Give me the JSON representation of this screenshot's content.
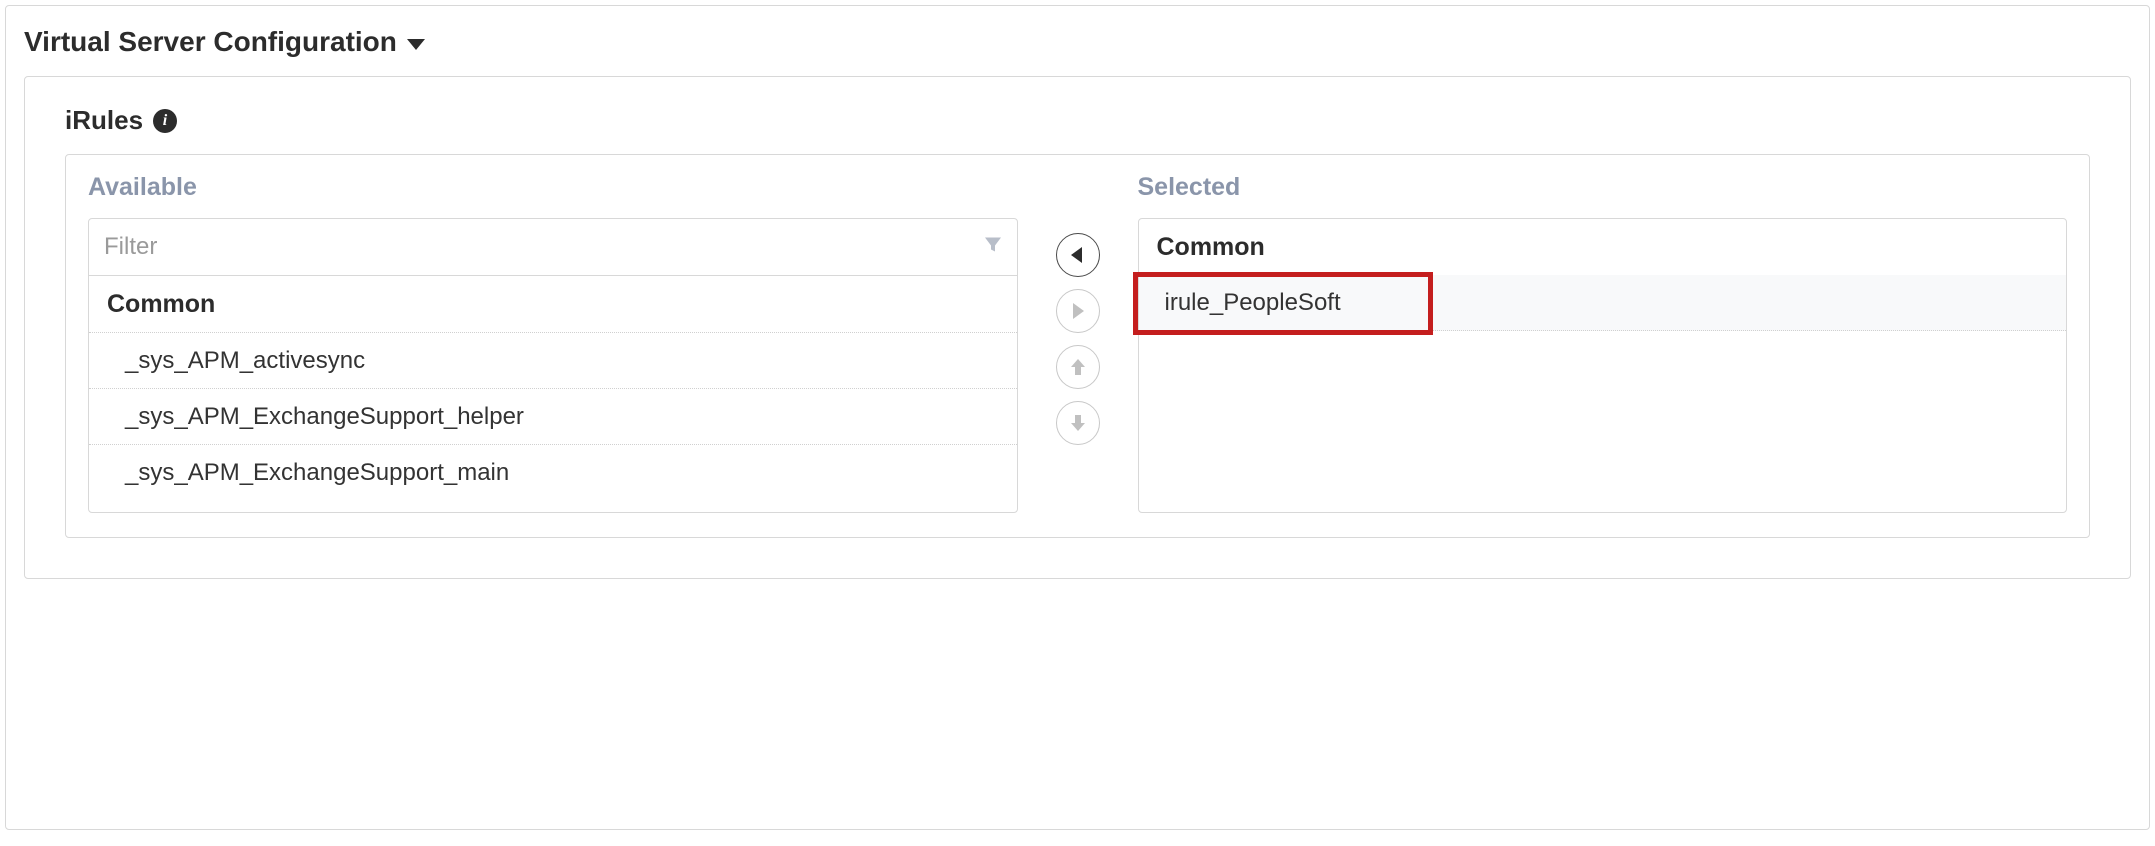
{
  "section": {
    "title": "Virtual Server Configuration"
  },
  "irules": {
    "label": "iRules",
    "available": {
      "title": "Available",
      "filter_placeholder": "Filter",
      "group": "Common",
      "items": [
        "_sys_APM_activesync",
        "_sys_APM_ExchangeSupport_helper",
        "_sys_APM_ExchangeSupport_main"
      ]
    },
    "selected": {
      "title": "Selected",
      "group": "Common",
      "items": [
        "irule_PeopleSoft"
      ]
    }
  }
}
